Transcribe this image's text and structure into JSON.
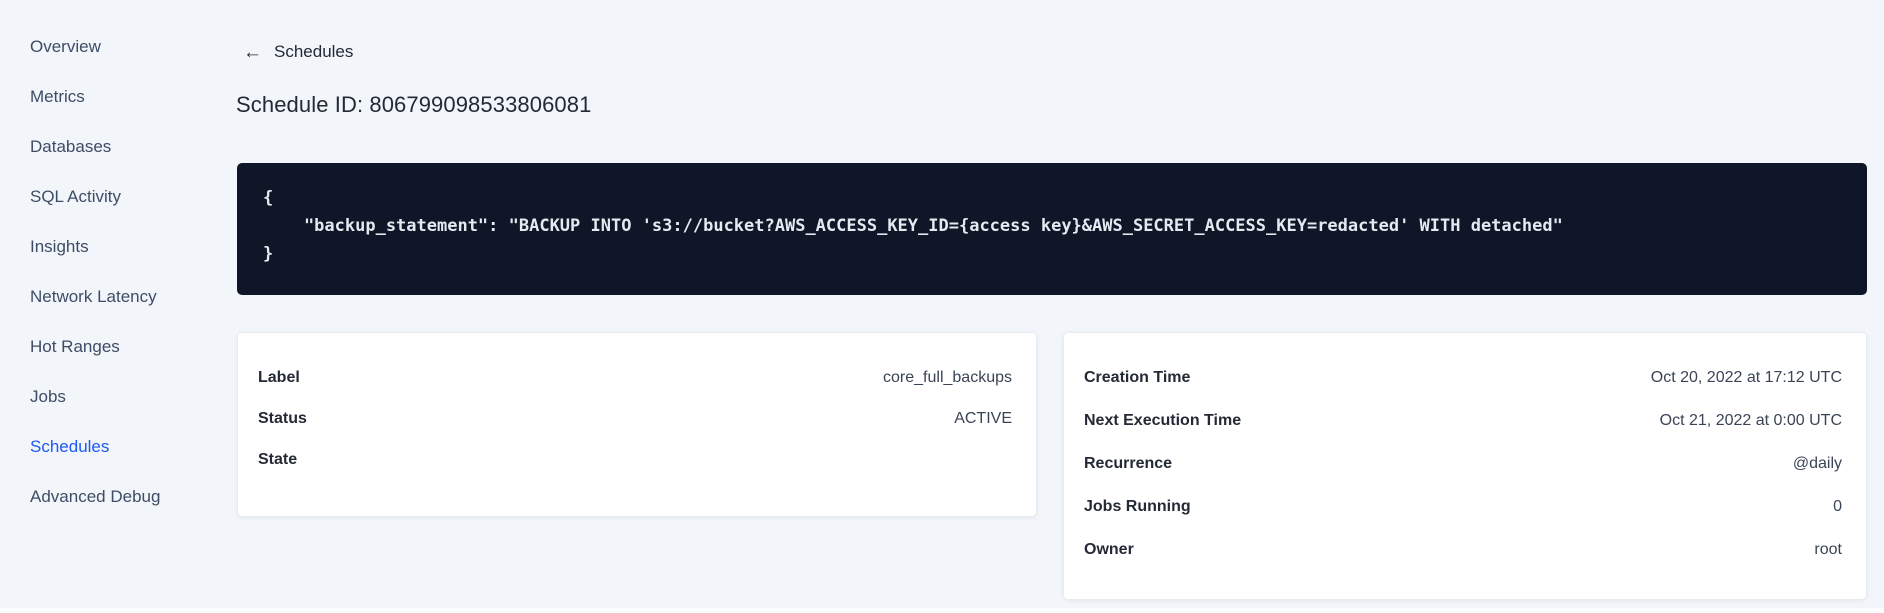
{
  "colors": {
    "background": "#f2f5f9",
    "accent_blue": "#1b59f4",
    "code_background": "#0e1627",
    "code_text": "#e5e9f0",
    "text_dark": "#242a35",
    "sidebar_text": "#3e4d66",
    "card_background": "#ffffff"
  },
  "sidebar": {
    "items": [
      {
        "label": "Overview",
        "active": false
      },
      {
        "label": "Metrics",
        "active": false
      },
      {
        "label": "Databases",
        "active": false
      },
      {
        "label": "SQL Activity",
        "active": false
      },
      {
        "label": "Insights",
        "active": false
      },
      {
        "label": "Network Latency",
        "active": false
      },
      {
        "label": "Hot Ranges",
        "active": false
      },
      {
        "label": "Jobs",
        "active": false
      },
      {
        "label": "Schedules",
        "active": true
      },
      {
        "label": "Advanced Debug",
        "active": false
      }
    ]
  },
  "page": {
    "back_label": "Schedules",
    "back_arrow": "←",
    "title": "Schedule ID: 806799098533806081"
  },
  "code_block": {
    "lines": [
      "{",
      "    \"backup_statement\": \"BACKUP INTO 's3://bucket?AWS_ACCESS_KEY_ID={access key}&AWS_SECRET_ACCESS_KEY=redacted' WITH detached\"",
      "}"
    ]
  },
  "details_card": {
    "rows": [
      {
        "label": "Label",
        "value": "core_full_backups"
      },
      {
        "label": "Status",
        "value": "ACTIVE"
      },
      {
        "label": "State",
        "value": ""
      }
    ]
  },
  "schedule_card": {
    "rows": [
      {
        "label": "Creation Time",
        "value": "Oct 20, 2022 at 17:12 UTC"
      },
      {
        "label": "Next Execution Time",
        "value": "Oct 21, 2022 at 0:00 UTC"
      },
      {
        "label": "Recurrence",
        "value": "@daily"
      },
      {
        "label": "Jobs Running",
        "value": "0"
      },
      {
        "label": "Owner",
        "value": "root"
      }
    ]
  }
}
